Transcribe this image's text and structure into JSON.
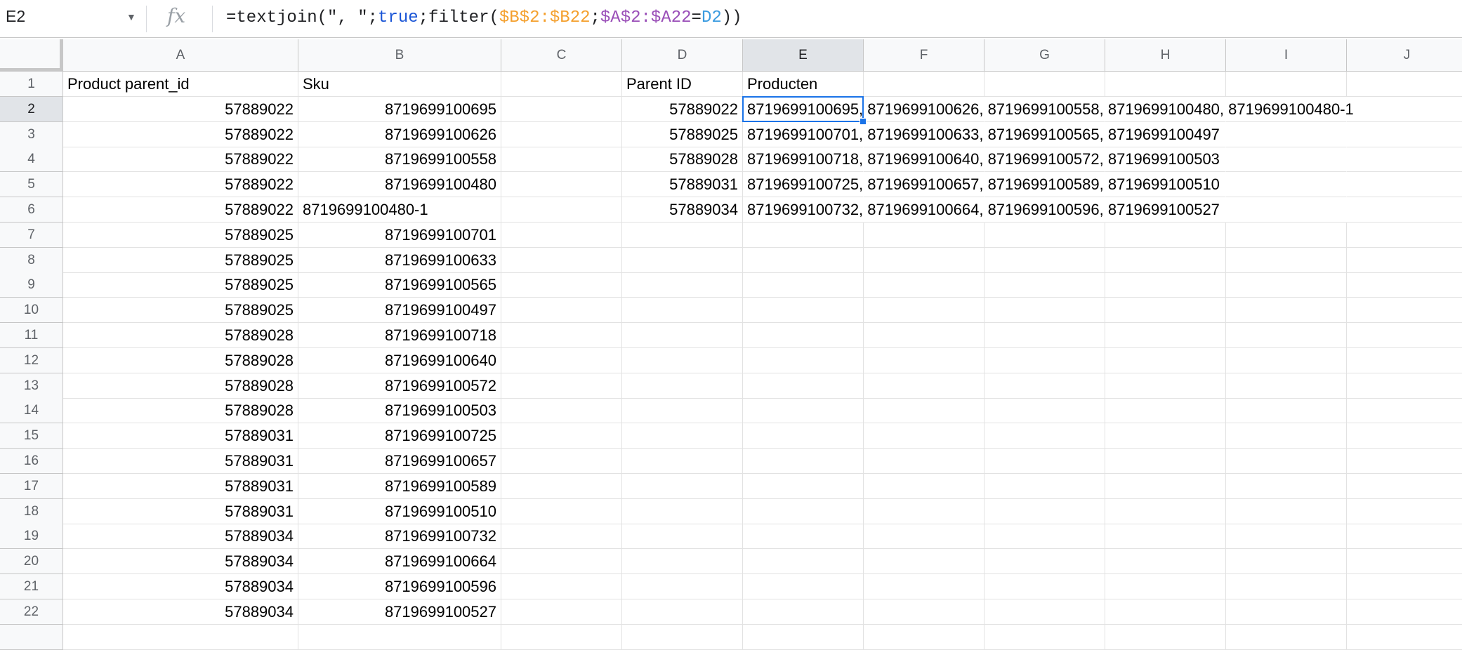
{
  "formula_bar": {
    "name_box": "E2",
    "fx_label": "fx",
    "formula_parts": [
      {
        "text": "=textjoin(\", \";",
        "color": "default"
      },
      {
        "text": "true",
        "color": "blue"
      },
      {
        "text": ";filter(",
        "color": "default"
      },
      {
        "text": "$B$2:$B22",
        "color": "orange"
      },
      {
        "text": ";",
        "color": "default"
      },
      {
        "text": "$A$2:$A22",
        "color": "purple"
      },
      {
        "text": "=",
        "color": "default"
      },
      {
        "text": "D2",
        "color": "cyan"
      },
      {
        "text": "))",
        "color": "default"
      }
    ]
  },
  "selected_cell": "E2",
  "columns": [
    "A",
    "B",
    "C",
    "D",
    "E",
    "F",
    "G",
    "H",
    "I",
    "J"
  ],
  "row_numbers": [
    1,
    2,
    3,
    4,
    5,
    6,
    7,
    8,
    9,
    10,
    11,
    12,
    13,
    14,
    15,
    16,
    17,
    18,
    19,
    20,
    21,
    22
  ],
  "sheet": {
    "headers": {
      "A": "Product parent_id",
      "B": "Sku",
      "D": "Parent ID",
      "E": "Producten"
    },
    "rows": [
      [
        "57889022",
        "8719699100695"
      ],
      [
        "57889022",
        "8719699100626"
      ],
      [
        "57889022",
        "8719699100558"
      ],
      [
        "57889022",
        "8719699100480"
      ],
      [
        "57889022",
        "8719699100480-1"
      ],
      [
        "57889025",
        "8719699100701"
      ],
      [
        "57889025",
        "8719699100633"
      ],
      [
        "57889025",
        "8719699100565"
      ],
      [
        "57889025",
        "8719699100497"
      ],
      [
        "57889028",
        "8719699100718"
      ],
      [
        "57889028",
        "8719699100640"
      ],
      [
        "57889028",
        "8719699100572"
      ],
      [
        "57889028",
        "8719699100503"
      ],
      [
        "57889031",
        "8719699100725"
      ],
      [
        "57889031",
        "8719699100657"
      ],
      [
        "57889031",
        "8719699100589"
      ],
      [
        "57889031",
        "8719699100510"
      ],
      [
        "57889034",
        "8719699100732"
      ],
      [
        "57889034",
        "8719699100664"
      ],
      [
        "57889034",
        "8719699100596"
      ],
      [
        "57889034",
        "8719699100527"
      ]
    ],
    "summary": [
      [
        "57889022",
        "8719699100695, 8719699100626, 8719699100558, 8719699100480, 8719699100480-1"
      ],
      [
        "57889025",
        "8719699100701, 8719699100633, 8719699100565, 8719699100497"
      ],
      [
        "57889028",
        "8719699100718, 8719699100640, 8719699100572, 8719699100503"
      ],
      [
        "57889031",
        "8719699100725, 8719699100657, 8719699100589, 8719699100510"
      ],
      [
        "57889034",
        "8719699100732, 8719699100664, 8719699100596, 8719699100527"
      ]
    ]
  },
  "colors": {
    "selection": "#1a73e8",
    "blue": "#1a55d6",
    "orange": "#f4a02e",
    "purple": "#9a4fb8",
    "cyan": "#3a9be0"
  }
}
